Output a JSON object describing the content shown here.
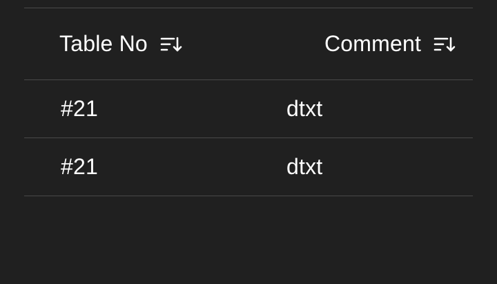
{
  "table": {
    "columns": [
      {
        "label": "Table No",
        "sort_icon": "sort-descending-icon"
      },
      {
        "label": "Comment",
        "sort_icon": "sort-descending-icon"
      }
    ],
    "rows": [
      {
        "table_no": "#21",
        "comment": "dtxt"
      },
      {
        "table_no": "#21",
        "comment": "dtxt"
      }
    ]
  }
}
